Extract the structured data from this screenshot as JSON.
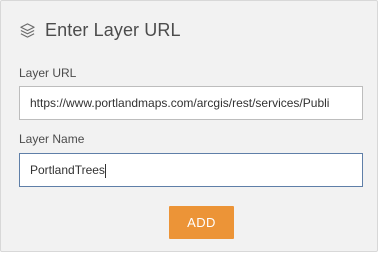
{
  "dialog": {
    "title": "Enter Layer URL",
    "title_icon": "layers-icon"
  },
  "layer_url": {
    "label": "Layer URL",
    "value": "https://www.portlandmaps.com/arcgis/rest/services/Publi"
  },
  "layer_name": {
    "label": "Layer Name",
    "value": "PortlandTrees"
  },
  "actions": {
    "add_label": "ADD"
  },
  "colors": {
    "panel_background": "#f2f2f2",
    "add_button": "#ec9437",
    "focused_border": "#5f7fa8"
  }
}
